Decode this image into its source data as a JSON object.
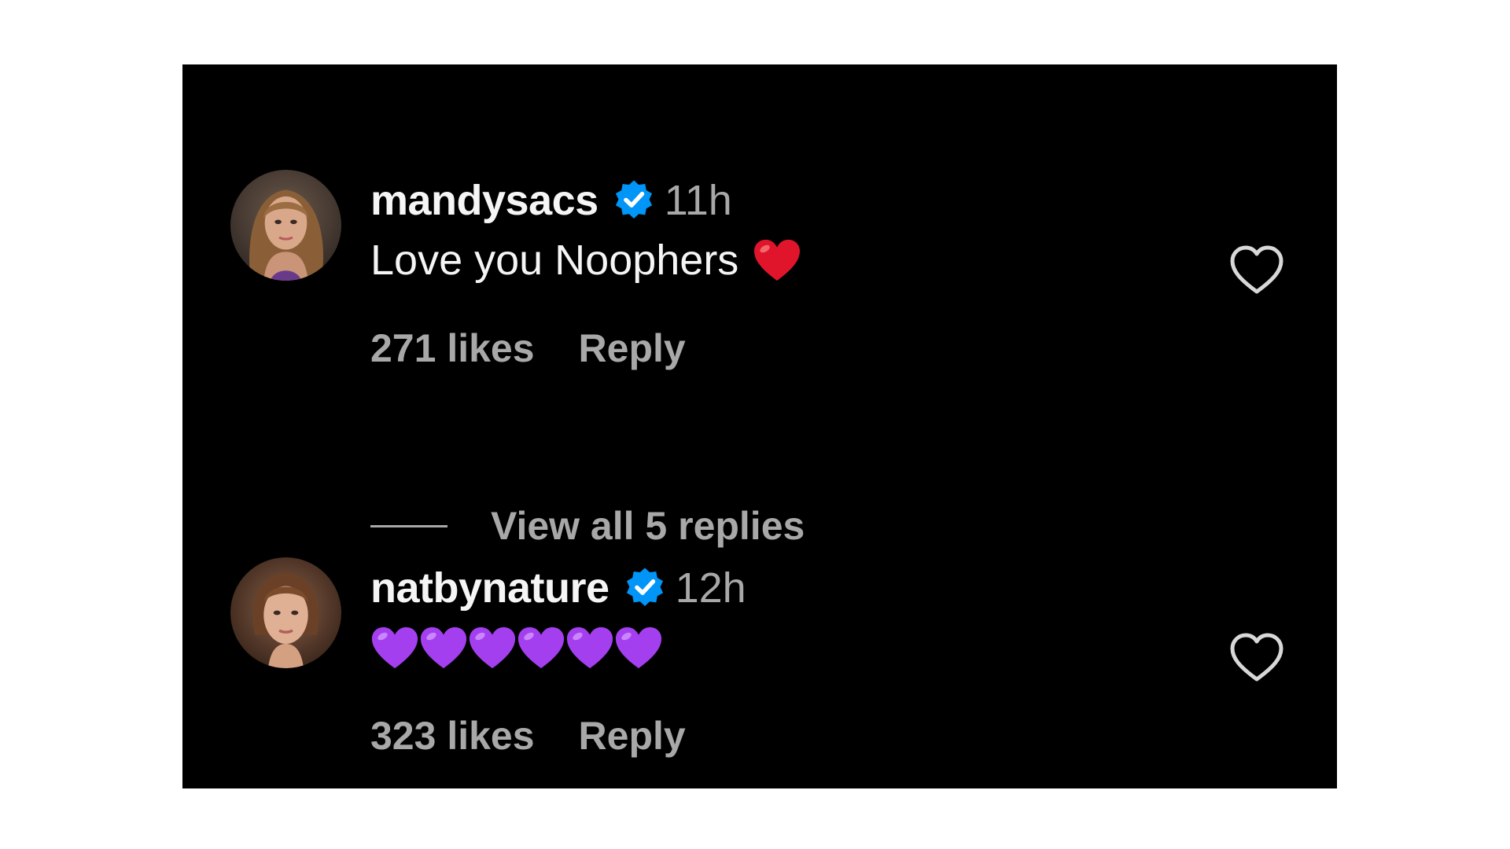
{
  "comments": [
    {
      "username": "mandysacs",
      "verified_icon": "verified-badge-icon",
      "timestamp": "11h",
      "text": "Love you Noophers",
      "emoji": "red-heart",
      "likes": "271 likes",
      "reply_label": "Reply",
      "view_replies": "View all 5 replies"
    },
    {
      "username": "natbynature",
      "verified_icon": "verified-badge-icon",
      "timestamp": "12h",
      "text": "",
      "emoji": "purple-heart",
      "emoji_count": 6,
      "likes": "323 likes",
      "reply_label": "Reply"
    }
  ],
  "colors": {
    "background": "#000000",
    "primary_text": "#f5f5f5",
    "secondary_text": "#a8a8a8",
    "verified_blue": "#0095f6",
    "red_heart": "#e0152b",
    "purple_heart": "#a43ff0"
  }
}
